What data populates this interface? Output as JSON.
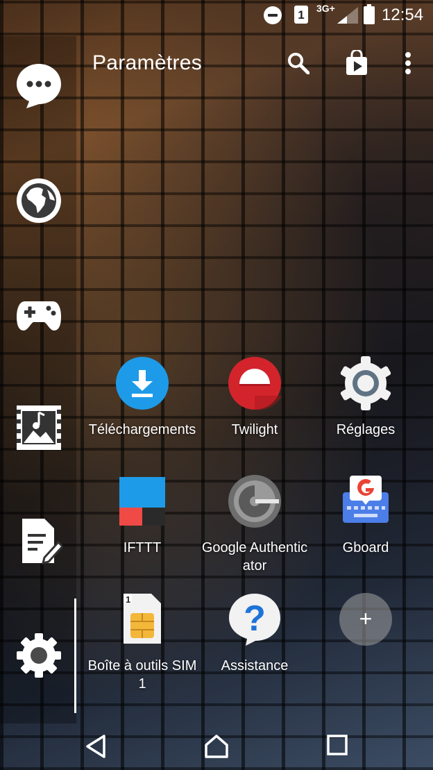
{
  "status_bar": {
    "sim_slot": "1",
    "network": "3G+",
    "time": "12:54",
    "icons": [
      "do-not-disturb-icon",
      "sim-1-icon",
      "signal-icon",
      "battery-icon"
    ]
  },
  "header": {
    "title": "Paramètres",
    "actions": [
      "search-icon",
      "play-store-icon",
      "overflow-menu-icon"
    ]
  },
  "sidebar": {
    "items": [
      {
        "name": "messages",
        "icon": "chat-bubble-icon"
      },
      {
        "name": "browser",
        "icon": "globe-icon"
      },
      {
        "name": "games",
        "icon": "gamepad-icon"
      },
      {
        "name": "media",
        "icon": "music-photo-icon"
      },
      {
        "name": "notes",
        "icon": "edit-document-icon"
      },
      {
        "name": "settings",
        "icon": "gear-icon"
      }
    ]
  },
  "apps": [
    {
      "label": "Téléchargements",
      "icon": "download-icon",
      "color": "#1E9BE8"
    },
    {
      "label": "Twilight",
      "icon": "twilight-icon",
      "color": "#D3242C"
    },
    {
      "label": "Réglages",
      "icon": "settings-gear-icon",
      "color": "#5F7384"
    },
    {
      "label": "IFTTT",
      "icon": "ifttt-icon",
      "color": "#F04A46"
    },
    {
      "label": "Google Authenticator",
      "icon": "authenticator-icon",
      "color": "#6E6E6E"
    },
    {
      "label": "Gboard",
      "icon": "gboard-icon",
      "color": "#4C7EE8"
    },
    {
      "label": "Boîte à outils SIM1",
      "icon": "sim-toolkit-icon",
      "color": "#F3B73A"
    },
    {
      "label": "Assistance",
      "icon": "help-icon",
      "color": "#1E73D8"
    },
    {
      "label": "+",
      "icon": "add-icon",
      "color": "#9E9E9E"
    }
  ],
  "nav_bar": [
    "back-icon",
    "home-icon",
    "recents-icon"
  ]
}
